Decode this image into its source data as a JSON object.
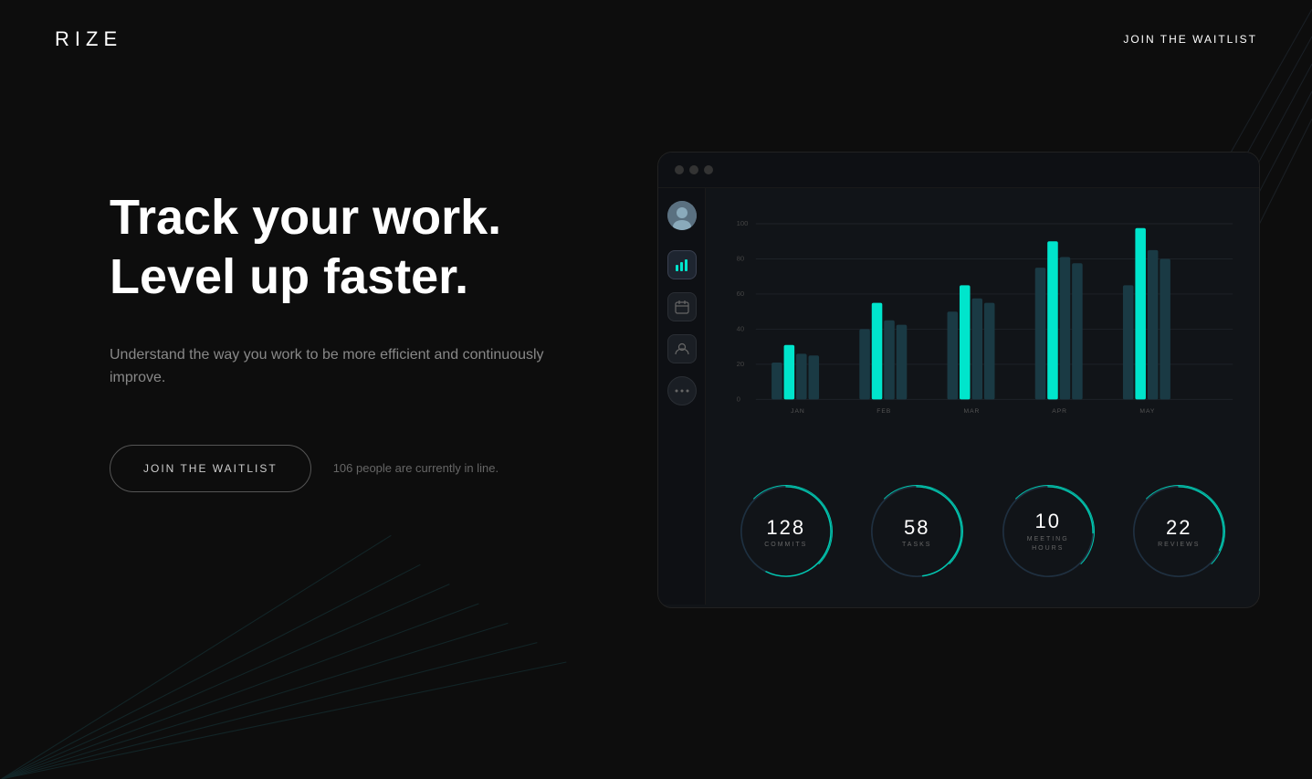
{
  "brand": {
    "logo": "RIZE"
  },
  "nav": {
    "waitlist_label": "JOIN THE WAITLIST"
  },
  "hero": {
    "title_line1": "Track your work.",
    "title_line2": "Level up faster.",
    "subtitle": "Understand the way you work to be more efficient and continuously improve.",
    "cta_button": "JOIN THE WAITLIST",
    "waitlist_count": "106 people are currently in line."
  },
  "dashboard": {
    "chart": {
      "y_labels": [
        "100",
        "80",
        "60",
        "40",
        "20",
        "0"
      ],
      "x_labels": [
        "JAN",
        "FEB",
        "MAR",
        "APR",
        "MAY"
      ],
      "accent_color": "#00e5cc"
    },
    "stats": [
      {
        "value": "128",
        "label": "COMMITS"
      },
      {
        "value": "58",
        "label": "TASKS"
      },
      {
        "value": "10",
        "label": "MEETING\nHOURS"
      },
      {
        "value": "22",
        "label": "REVIEWS"
      }
    ],
    "sidebar_icons": [
      {
        "name": "chart-icon",
        "symbol": "📊",
        "active": true
      },
      {
        "name": "calendar-icon",
        "symbol": "📅",
        "active": false
      },
      {
        "name": "user-icon",
        "symbol": "👤",
        "active": false
      },
      {
        "name": "more-icon",
        "symbol": "•••",
        "active": false
      }
    ]
  },
  "colors": {
    "accent": "#00e5cc",
    "bg": "#0d0d0d",
    "text_muted": "#888888",
    "dashboard_bg": "#111418"
  }
}
